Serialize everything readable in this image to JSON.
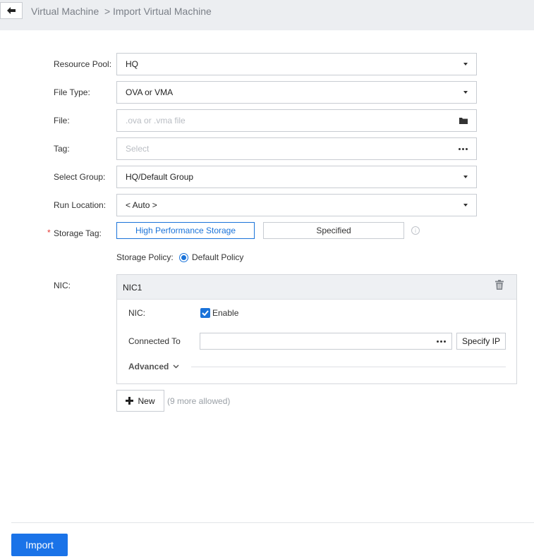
{
  "breadcrumb": {
    "parent": "Virtual Machine",
    "separator": ">",
    "current": "Import Virtual Machine"
  },
  "form": {
    "resource_pool": {
      "label": "Resource Pool:",
      "value": "HQ"
    },
    "file_type": {
      "label": "File Type:",
      "value": "OVA or VMA"
    },
    "file": {
      "label": "File:",
      "placeholder": ".ova or .vma file"
    },
    "tag": {
      "label": "Tag:",
      "placeholder": "Select"
    },
    "select_group": {
      "label": "Select Group:",
      "value": "HQ/Default Group"
    },
    "run_location": {
      "label": "Run Location:",
      "value": "< Auto >"
    },
    "storage_tag": {
      "required_mark": "*",
      "label": "Storage Tag:",
      "options": [
        "High Performance Storage",
        "Specified"
      ],
      "selected": "High Performance Storage"
    },
    "storage_policy": {
      "label": "Storage Policy:",
      "value": "Default Policy"
    },
    "nic": {
      "label": "NIC:",
      "panel_title": "NIC1",
      "nic_label": "NIC:",
      "enable_label": "Enable",
      "enabled": true,
      "connected_to_label": "Connected To",
      "connected_to_value": "",
      "specify_ip_label": "Specify IP",
      "advanced_label": "Advanced"
    },
    "new_button_label": "New",
    "more_allowed": "(9 more allowed)"
  },
  "footer": {
    "import_label": "Import"
  },
  "colors": {
    "accent": "#1a73e8",
    "topbar_bg": "#eceef1",
    "required": "#e53935"
  }
}
